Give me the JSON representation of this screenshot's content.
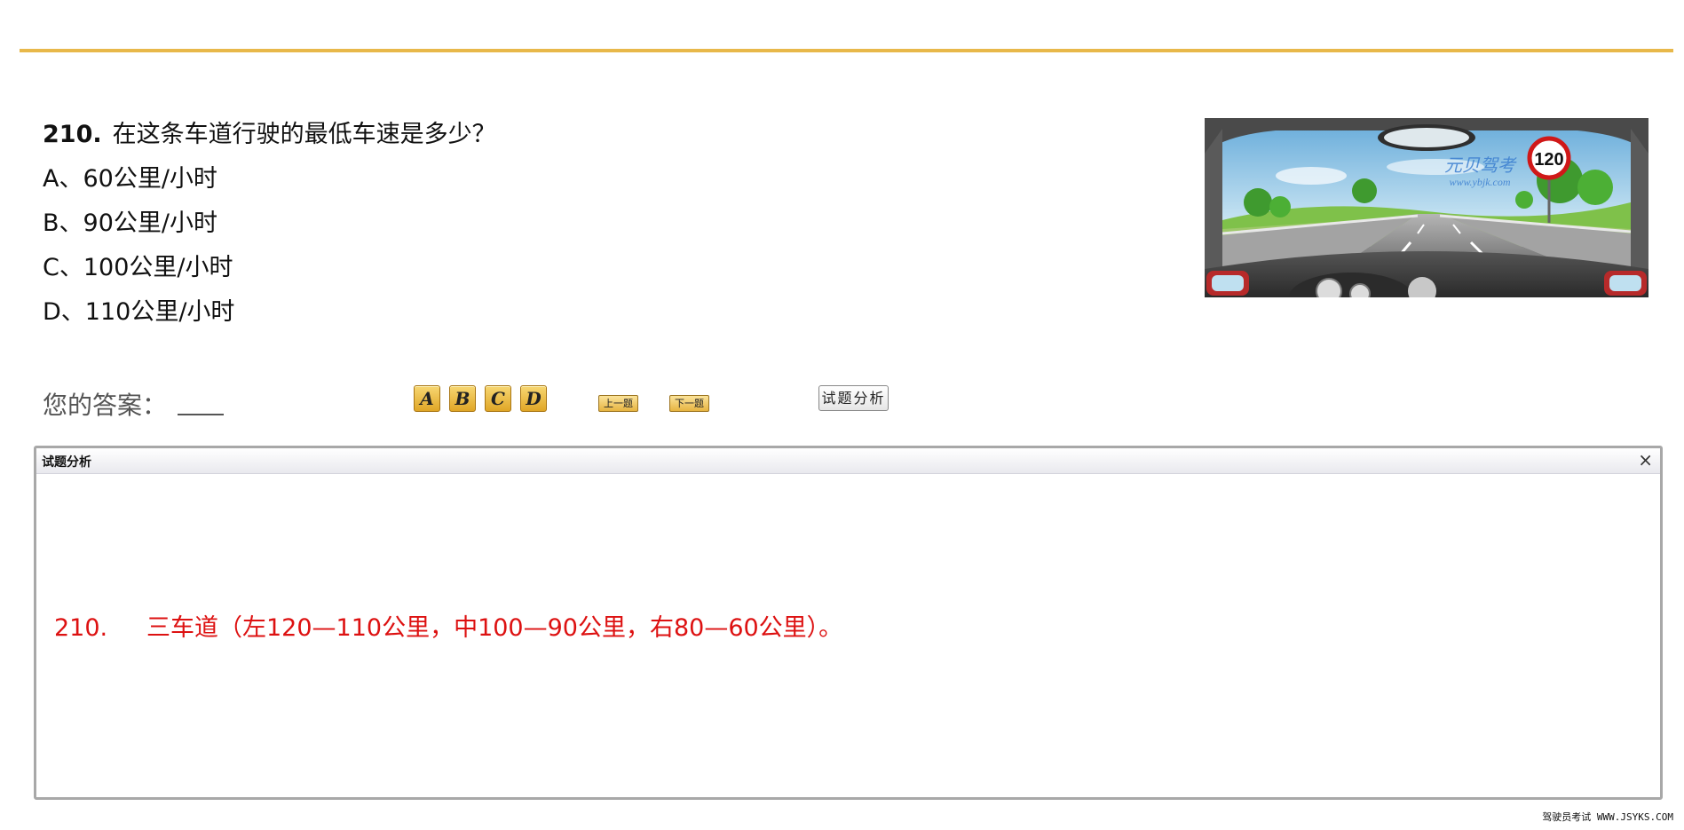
{
  "question": {
    "number": "210.",
    "text": "在这条车道行驶的最低车速是多少？",
    "options": [
      "A、60公里/小时",
      "B、90公里/小时",
      "C、100公里/小时",
      "D、110公里/小时"
    ]
  },
  "image": {
    "watermark_title": "元贝驾考",
    "watermark_url": "www.ybjk.com",
    "sign_value": "120"
  },
  "answer": {
    "label": "您的答案：",
    "choice_buttons": [
      "A",
      "B",
      "C",
      "D"
    ],
    "prev_label": "上一题",
    "next_label": "下一题",
    "analysis_label": "试题分析"
  },
  "analysis_panel": {
    "title": "试题分析",
    "close": "×",
    "number": "210.",
    "text": "三车道（左120—110公里，中100—90公里，右80—60公里）。"
  },
  "footer": "驾驶员考试 WWW.JSYKS.COM"
}
